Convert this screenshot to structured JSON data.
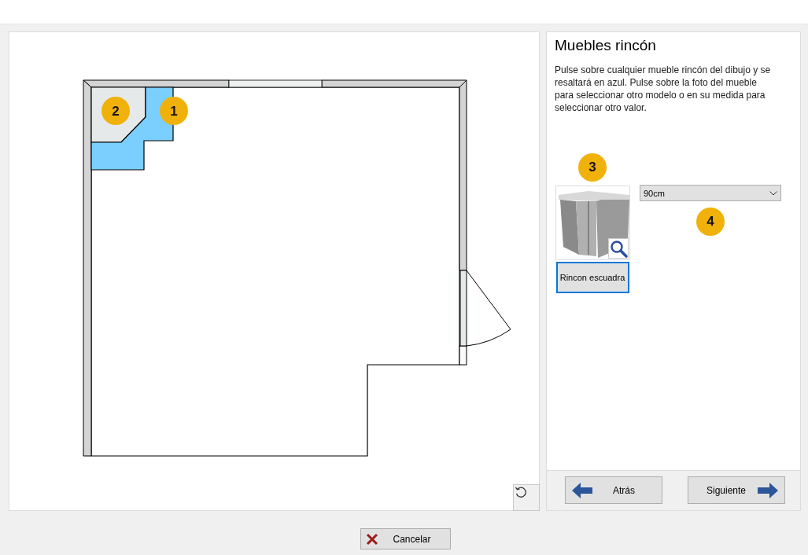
{
  "plan": {
    "cabinets": [
      {
        "badge": "2",
        "selected": false
      },
      {
        "badge": "1",
        "selected": true
      }
    ]
  },
  "panel": {
    "title": "Muebles rincón",
    "description": "Pulse sobre cualquier mueble rincón del dibujo y se resaltará en azul. Pulse sobre la foto del mueble para seleccionar otro modelo o en su medida para seleccionar otro valor.",
    "model": {
      "badge": "3",
      "name": "Rincon escuadra",
      "selected": true
    },
    "size": {
      "badge": "4",
      "value": "90cm"
    }
  },
  "nav": {
    "back": "Atrás",
    "next": "Siguiente"
  },
  "cancel": "Cancelar"
}
